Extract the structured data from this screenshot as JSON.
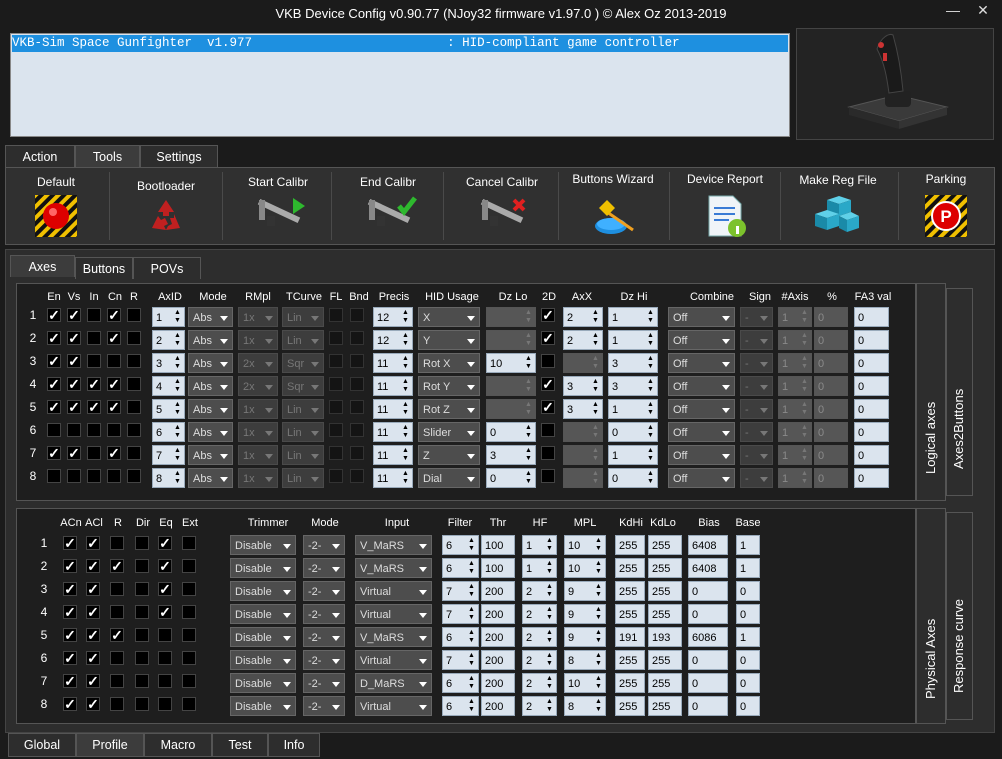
{
  "window": {
    "title": "VKB Device Config v0.90.77 (NJoy32 firmware v1.97.0  ) © Alex Oz 2013-2019",
    "minimize": "—",
    "close": "✕"
  },
  "device": {
    "row": "VKB-Sim Space Gunfighter  v1.977                          : HID-compliant game controller"
  },
  "main_tabs": [
    "Action",
    "Tools",
    "Settings"
  ],
  "tools": [
    {
      "label": "Default",
      "icon": "red-button-icon"
    },
    {
      "label": "Bootloader",
      "icon": "recycle-icon"
    },
    {
      "label": "Start Calibr",
      "icon": "caliper-play-icon"
    },
    {
      "label": "End Calibr",
      "icon": "caliper-check-icon"
    },
    {
      "label": "Cancel Calibr",
      "icon": "caliper-cancel-icon"
    },
    {
      "label": "Buttons Wizard",
      "icon": "wizard-icon"
    },
    {
      "label": "Device Report",
      "icon": "report-icon"
    },
    {
      "label": "Make Reg File",
      "icon": "cubes-icon"
    },
    {
      "label": "Parking",
      "icon": "parking-icon"
    }
  ],
  "sub_tabs": [
    "Axes",
    "Buttons",
    "POVs"
  ],
  "logical": {
    "side_labels": [
      "Logical axes",
      "Axes2Buttons"
    ],
    "headers": [
      "En",
      "Vs",
      "In",
      "Cn",
      "R",
      "AxID",
      "Mode",
      "RMpl",
      "TCurve",
      "FL",
      "Bnd",
      "Precis",
      "HID Usage",
      "Dz Lo",
      "2D",
      "AxX",
      "Dz Hi",
      "Combine",
      "Sign",
      "#Axis",
      "%",
      "FA3 val"
    ],
    "rows": [
      {
        "n": "1",
        "en": true,
        "vs": true,
        "in": false,
        "cn": true,
        "r": false,
        "axid": "1",
        "mode": "Abs",
        "rmpl": "1x",
        "tcurve": "Lin",
        "precis": "12",
        "usage": "X",
        "dzlo": "",
        "dzlo_en": false,
        "twod": true,
        "axx": "2",
        "axx_en": true,
        "dzhi": "1",
        "combine": "Off",
        "sign": "-",
        "naxis": "1",
        "pct": "0",
        "fa3": "0"
      },
      {
        "n": "2",
        "en": true,
        "vs": true,
        "in": false,
        "cn": true,
        "r": false,
        "axid": "2",
        "mode": "Abs",
        "rmpl": "1x",
        "tcurve": "Lin",
        "precis": "12",
        "usage": "Y",
        "dzlo": "",
        "dzlo_en": false,
        "twod": true,
        "axx": "2",
        "axx_en": true,
        "dzhi": "1",
        "combine": "Off",
        "sign": "-",
        "naxis": "1",
        "pct": "0",
        "fa3": "0"
      },
      {
        "n": "3",
        "en": true,
        "vs": true,
        "in": false,
        "cn": false,
        "r": false,
        "axid": "3",
        "mode": "Abs",
        "rmpl": "2x",
        "tcurve": "Sqr",
        "precis": "11",
        "usage": "Rot X",
        "dzlo": "10",
        "dzlo_en": true,
        "twod": false,
        "axx": "",
        "axx_en": false,
        "dzhi": "3",
        "combine": "Off",
        "sign": "-",
        "naxis": "1",
        "pct": "0",
        "fa3": "0"
      },
      {
        "n": "4",
        "en": true,
        "vs": true,
        "in": true,
        "cn": true,
        "r": false,
        "axid": "4",
        "mode": "Abs",
        "rmpl": "2x",
        "tcurve": "Sqr",
        "precis": "11",
        "usage": "Rot Y",
        "dzlo": "",
        "dzlo_en": false,
        "twod": true,
        "axx": "3",
        "axx_en": true,
        "dzhi": "3",
        "combine": "Off",
        "sign": "-",
        "naxis": "1",
        "pct": "0",
        "fa3": "0"
      },
      {
        "n": "5",
        "en": true,
        "vs": true,
        "in": true,
        "cn": true,
        "r": false,
        "axid": "5",
        "mode": "Abs",
        "rmpl": "1x",
        "tcurve": "Lin",
        "precis": "11",
        "usage": "Rot Z",
        "dzlo": "",
        "dzlo_en": false,
        "twod": true,
        "axx": "3",
        "axx_en": true,
        "dzhi": "1",
        "combine": "Off",
        "sign": "-",
        "naxis": "1",
        "pct": "0",
        "fa3": "0"
      },
      {
        "n": "6",
        "en": false,
        "vs": false,
        "in": false,
        "cn": false,
        "r": false,
        "axid": "6",
        "mode": "Abs",
        "rmpl": "1x",
        "tcurve": "Lin",
        "precis": "11",
        "usage": "Slider",
        "dzlo": "0",
        "dzlo_en": true,
        "twod": false,
        "axx": "",
        "axx_en": false,
        "dzhi": "0",
        "combine": "Off",
        "sign": "-",
        "naxis": "1",
        "pct": "0",
        "fa3": "0"
      },
      {
        "n": "7",
        "en": true,
        "vs": true,
        "in": false,
        "cn": true,
        "r": false,
        "axid": "7",
        "mode": "Abs",
        "rmpl": "1x",
        "tcurve": "Lin",
        "precis": "11",
        "usage": "Z",
        "dzlo": "3",
        "dzlo_en": true,
        "twod": false,
        "axx": "",
        "axx_en": false,
        "dzhi": "1",
        "combine": "Off",
        "sign": "-",
        "naxis": "1",
        "pct": "0",
        "fa3": "0"
      },
      {
        "n": "8",
        "en": false,
        "vs": false,
        "in": false,
        "cn": false,
        "r": false,
        "axid": "8",
        "mode": "Abs",
        "rmpl": "1x",
        "tcurve": "Lin",
        "precis": "11",
        "usage": "Dial",
        "dzlo": "0",
        "dzlo_en": true,
        "twod": false,
        "axx": "",
        "axx_en": false,
        "dzhi": "0",
        "combine": "Off",
        "sign": "-",
        "naxis": "1",
        "pct": "0",
        "fa3": "0"
      }
    ]
  },
  "physical": {
    "side_labels": [
      "Physical Axes",
      "Response curve"
    ],
    "headers": [
      "ACn",
      "ACl",
      "R",
      "Dir",
      "Eq",
      "Ext",
      "Trimmer",
      "Mode",
      "Input",
      "Filter",
      "Thr",
      "HF",
      "MPL",
      "KdHi",
      "KdLo",
      "Bias",
      "Base"
    ],
    "rows": [
      {
        "n": "1",
        "acn": true,
        "acl": true,
        "r": false,
        "dir": false,
        "eq": true,
        "ext": false,
        "trimmer": "Disable",
        "mode": "-2-",
        "input": "V_MaRS",
        "filter": "6",
        "thr": "100",
        "hf": "1",
        "mpl": "10",
        "kdhi": "255",
        "kdlo": "255",
        "bias": "6408",
        "base": "1"
      },
      {
        "n": "2",
        "acn": true,
        "acl": true,
        "r": true,
        "dir": false,
        "eq": true,
        "ext": false,
        "trimmer": "Disable",
        "mode": "-2-",
        "input": "V_MaRS",
        "filter": "6",
        "thr": "100",
        "hf": "1",
        "mpl": "10",
        "kdhi": "255",
        "kdlo": "255",
        "bias": "6408",
        "base": "1"
      },
      {
        "n": "3",
        "acn": true,
        "acl": true,
        "r": false,
        "dir": false,
        "eq": true,
        "ext": false,
        "trimmer": "Disable",
        "mode": "-2-",
        "input": "Virtual",
        "filter": "7",
        "thr": "200",
        "hf": "2",
        "mpl": "9",
        "kdhi": "255",
        "kdlo": "255",
        "bias": "0",
        "base": "0"
      },
      {
        "n": "4",
        "acn": true,
        "acl": true,
        "r": false,
        "dir": false,
        "eq": true,
        "ext": false,
        "trimmer": "Disable",
        "mode": "-2-",
        "input": "Virtual",
        "filter": "7",
        "thr": "200",
        "hf": "2",
        "mpl": "9",
        "kdhi": "255",
        "kdlo": "255",
        "bias": "0",
        "base": "0"
      },
      {
        "n": "5",
        "acn": true,
        "acl": true,
        "r": true,
        "dir": false,
        "eq": false,
        "ext": false,
        "trimmer": "Disable",
        "mode": "-2-",
        "input": "V_MaRS",
        "filter": "6",
        "thr": "200",
        "hf": "2",
        "mpl": "9",
        "kdhi": "191",
        "kdlo": "193",
        "bias": "6086",
        "base": "1"
      },
      {
        "n": "6",
        "acn": true,
        "acl": true,
        "r": false,
        "dir": false,
        "eq": false,
        "ext": false,
        "trimmer": "Disable",
        "mode": "-2-",
        "input": "Virtual",
        "filter": "7",
        "thr": "200",
        "hf": "2",
        "mpl": "8",
        "kdhi": "255",
        "kdlo": "255",
        "bias": "0",
        "base": "0"
      },
      {
        "n": "7",
        "acn": true,
        "acl": true,
        "r": false,
        "dir": false,
        "eq": false,
        "ext": false,
        "trimmer": "Disable",
        "mode": "-2-",
        "input": "D_MaRS",
        "filter": "6",
        "thr": "200",
        "hf": "2",
        "mpl": "10",
        "kdhi": "255",
        "kdlo": "255",
        "bias": "0",
        "base": "0"
      },
      {
        "n": "8",
        "acn": true,
        "acl": true,
        "r": false,
        "dir": false,
        "eq": false,
        "ext": false,
        "trimmer": "Disable",
        "mode": "-2-",
        "input": "Virtual",
        "filter": "6",
        "thr": "200",
        "hf": "2",
        "mpl": "8",
        "kdhi": "255",
        "kdlo": "255",
        "bias": "0",
        "base": "0"
      }
    ]
  },
  "bottom_tabs": [
    "Global",
    "Profile",
    "Macro",
    "Test",
    "Info"
  ],
  "colors": {
    "accent": "#1e90e0",
    "field": "#dbe4ee",
    "panel": "#2d2d2d"
  }
}
